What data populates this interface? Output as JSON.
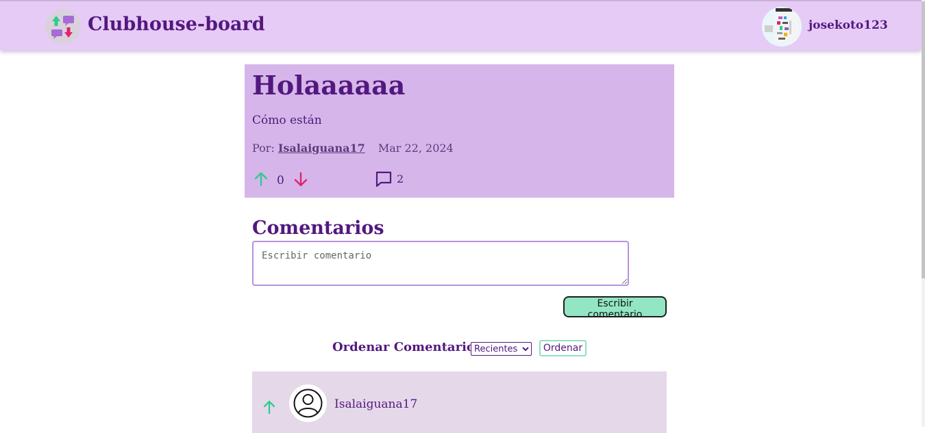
{
  "header": {
    "site_title": "Clubhouse-board",
    "username": "josekoto123"
  },
  "post": {
    "title": "Holaaaaaa",
    "body": "Cómo están",
    "by_label": "Por:",
    "author": "Isalaiguana17",
    "date": "Mar 22, 2024",
    "score": "0",
    "comment_count": "2"
  },
  "comments": {
    "heading": "Comentarios",
    "textarea_placeholder": "Escribir comentario",
    "submit_label": "Escribir comentario",
    "sort_label": "Ordenar Comentarios",
    "sort_selected": "Recientes",
    "sort_button": "Ordenar",
    "items": [
      {
        "author": "Isalaiguana17"
      }
    ]
  },
  "colors": {
    "header_bg": "#e6cbf6",
    "post_bg": "#d6b6ea",
    "primary_text": "#53187f",
    "upvote": "#2ecc8f",
    "downvote": "#e0246a",
    "submit_bg": "#93e6c4",
    "comment_card_bg": "#e5d8e9"
  },
  "icons": {
    "logo": "logo-icon",
    "upvote": "arrow-up-icon",
    "downvote": "arrow-down-icon",
    "comments": "comment-bubble-icon",
    "user": "user-circle-icon"
  }
}
